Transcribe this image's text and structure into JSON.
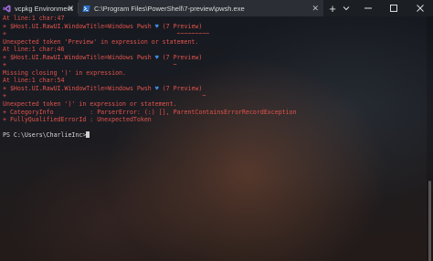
{
  "tabs": [
    {
      "label": "vcpkg Environment",
      "icon": "visual-studio-icon",
      "icon_color": "#9b6cd8"
    },
    {
      "label": "C:\\Program Files\\PowerShell\\7-preview\\pwsh.exe",
      "icon": "powershell-icon",
      "icon_color": "#3b7ed8",
      "active": true
    }
  ],
  "window_controls": {
    "new_tab": "+",
    "dropdown": "chevron-down-icon"
  },
  "colors": {
    "error": "#e2534d",
    "prompt": "#d7d7d7",
    "heart": "#3d8de0"
  },
  "terminal": {
    "lines": [
      {
        "text": "At line:1 char:47",
        "type": "error"
      },
      {
        "text": "+ $Host.UI.RawUI.WindowTitle=Windows Pwsh ",
        "type": "error",
        "heart": true,
        "suffix": " (7 Preview)"
      },
      {
        "text": "+                                               ~~~~~~~~~",
        "type": "error"
      },
      {
        "text": "Unexpected token 'Preview' in expression or statement.",
        "type": "error"
      },
      {
        "text": "At line:1 char:46",
        "type": "error"
      },
      {
        "text": "+ $Host.UI.RawUI.WindowTitle=Windows Pwsh ",
        "type": "error",
        "heart": true,
        "suffix": " (7 Preview)"
      },
      {
        "text": "+                                              ~",
        "type": "error"
      },
      {
        "text": "Missing closing ')' in expression.",
        "type": "error"
      },
      {
        "text": "At line:1 char:54",
        "type": "error"
      },
      {
        "text": "+ $Host.UI.RawUI.WindowTitle=Windows Pwsh ",
        "type": "error",
        "heart": true,
        "suffix": " (7 Preview)"
      },
      {
        "text": "+                                                      ~",
        "type": "error"
      },
      {
        "text": "Unexpected token ')' in expression or statement.",
        "type": "error"
      },
      {
        "text": "+ CategoryInfo          : ParserError: (:) [], ParentContainsErrorRecordException",
        "type": "error"
      },
      {
        "text": "+ FullyQualifiedErrorId : UnexpectedToken",
        "type": "error"
      },
      {
        "text": "",
        "type": "blank"
      },
      {
        "text": "PS C:\\Users\\CharlieInc>",
        "type": "prompt"
      }
    ]
  }
}
